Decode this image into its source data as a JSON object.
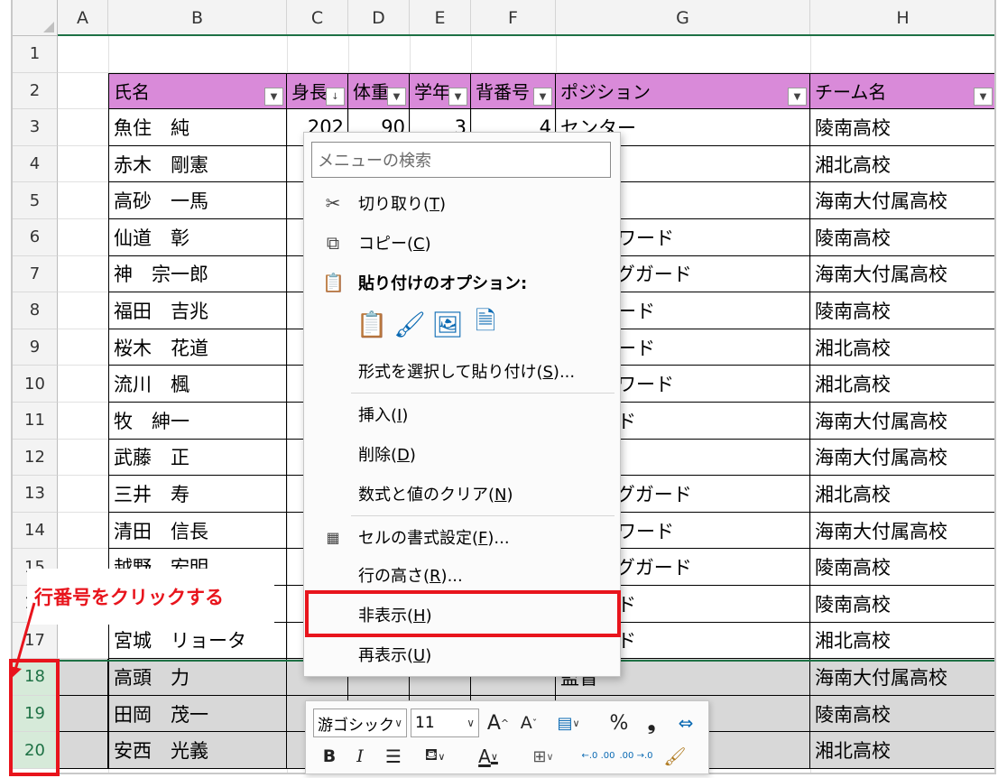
{
  "columns": [
    "A",
    "B",
    "C",
    "D",
    "E",
    "F",
    "G",
    "H"
  ],
  "rows": [
    "1",
    "2",
    "3",
    "4",
    "5",
    "6",
    "7",
    "8",
    "9",
    "10",
    "11",
    "12",
    "13",
    "14",
    "15",
    "16",
    "17",
    "18",
    "19",
    "20"
  ],
  "table": {
    "headers": [
      "氏名",
      "身長",
      "体重",
      "学年",
      "背番号",
      "ポジション",
      "チーム名"
    ],
    "rows": [
      {
        "name": "魚住　純",
        "height": "202",
        "weight": "90",
        "grade": "3",
        "number": "4",
        "position": "センター",
        "team": "陵南高校"
      },
      {
        "name": "赤木　剛憲",
        "position": "ー",
        "team": "湘北高校"
      },
      {
        "name": "高砂　一馬",
        "position": "ー",
        "team": "海南大付属高校"
      },
      {
        "name": "仙道　彰",
        "position": "ルフォワード",
        "team": "陵南高校"
      },
      {
        "name": "神　宗一郎",
        "position": "ティングガード",
        "team": "海南大付属高校"
      },
      {
        "name": "福田　吉兆",
        "position": "フォワード",
        "team": "陵南高校"
      },
      {
        "name": "桜木　花道",
        "position": "フォワード",
        "team": "湘北高校"
      },
      {
        "name": "流川　楓",
        "position": "ルフォワード",
        "team": "湘北高校"
      },
      {
        "name": "牧　紳一",
        "position": "トガード",
        "team": "海南大付属高校"
      },
      {
        "name": "武藤　正",
        "position": "ード",
        "team": "海南大付属高校"
      },
      {
        "name": "三井　寿",
        "position": "ティングガード",
        "team": "湘北高校"
      },
      {
        "name": "清田　信長",
        "position": "ルフォワード",
        "team": "海南大付属高校"
      },
      {
        "name": "越野　宏明",
        "position": "ティングガード",
        "team": "陵南高校"
      },
      {
        "name": "",
        "position": "トガード",
        "team": "陵南高校"
      },
      {
        "name": "宮城　リョータ",
        "position": "トガード",
        "team": "湘北高校"
      },
      {
        "name": "高頭　力",
        "position": "監督",
        "team": "海南大付属高校"
      },
      {
        "name": "田岡　茂一",
        "position": "",
        "team": "陵南高校"
      },
      {
        "name": "安西　光義",
        "position": "",
        "team": "湘北高校"
      }
    ]
  },
  "context_menu": {
    "search_placeholder": "メニューの検索",
    "cut": {
      "label": "切り取り(",
      "key": "T",
      "tail": ")"
    },
    "copy": {
      "label": "コピー(",
      "key": "C",
      "tail": ")"
    },
    "paste_options_label": "貼り付けのオプション:",
    "paste_special": {
      "label": "形式を選択して貼り付け(",
      "key": "S",
      "tail": ")..."
    },
    "insert": {
      "label": "挿入(",
      "key": "I",
      "tail": ")"
    },
    "delete": {
      "label": "削除(",
      "key": "D",
      "tail": ")"
    },
    "clear": {
      "label": "数式と値のクリア(",
      "key": "N",
      "tail": ")"
    },
    "format_cells": {
      "label": "セルの書式設定(",
      "key": "F",
      "tail": ")..."
    },
    "row_height": {
      "label": "行の高さ(",
      "key": "R",
      "tail": ")..."
    },
    "hide": {
      "label": "非表示(",
      "key": "H",
      "tail": ")"
    },
    "unhide": {
      "label": "再表示(",
      "key": "U",
      "tail": ")"
    }
  },
  "mini_toolbar": {
    "font_name": "游ゴシック",
    "font_size": "11",
    "percent": "%",
    "comma": "❟",
    "bold": "B",
    "italic": "I",
    "font_color_letter": "A",
    "inc_decimal": "←.0 .00",
    "dec_decimal": ".00 →.0"
  },
  "annotation": {
    "text": "行番号をクリックする",
    "color": "#e8141c"
  },
  "colors": {
    "header_fill": "#d98ad9",
    "selected_row_fill": "#d8d8d8",
    "selected_row_header": "#d6ead9"
  }
}
